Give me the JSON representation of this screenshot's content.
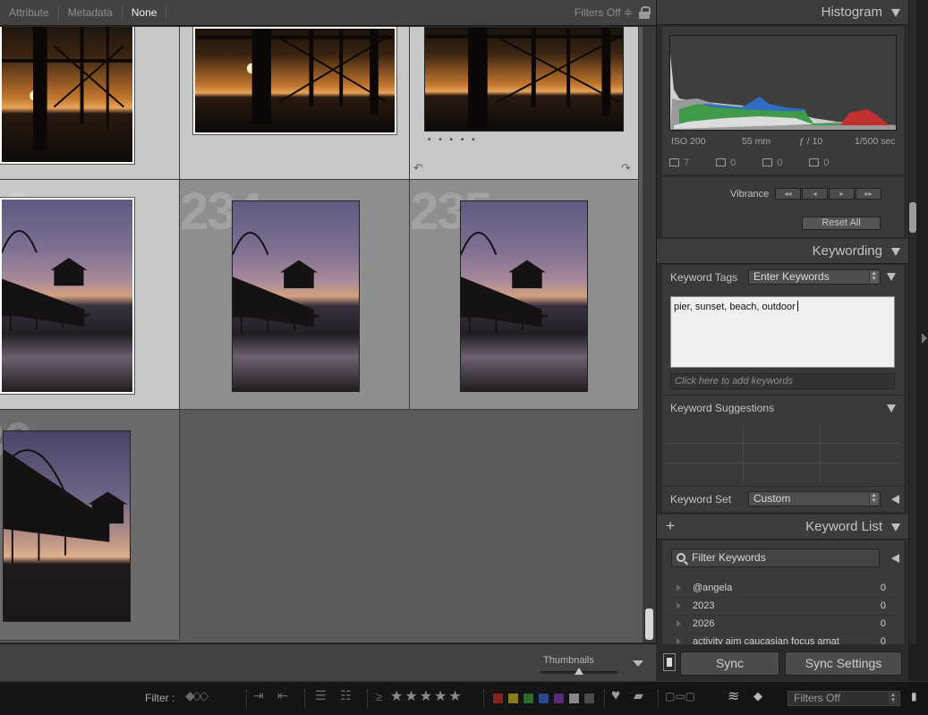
{
  "filter_bar": {
    "tabs": [
      "Attribute",
      "Metadata",
      "None"
    ],
    "selected_tab": "None",
    "filters_label": "Filters Off ≑"
  },
  "grid": {
    "cells": [
      {
        "number": "",
        "state": "selected"
      },
      {
        "number": "",
        "state": "selected"
      },
      {
        "number": "",
        "state": "selected"
      },
      {
        "number": "233",
        "state": "selected"
      },
      {
        "number": "234",
        "state": "unselected"
      },
      {
        "number": "235",
        "state": "unselected"
      },
      {
        "number": "236",
        "state": "dim"
      }
    ],
    "dots": "• • • • •"
  },
  "toolbar": {
    "thumbnails_label": "Thumbnails",
    "thumbnail_size": 0.5
  },
  "histogram": {
    "title": "Histogram",
    "iso": "ISO 200",
    "focal": "55 mm",
    "aperture": "ƒ / 10",
    "shutter": "1/500 sec",
    "counts": [
      "7",
      "0",
      "0",
      "0"
    ]
  },
  "quick_develop": {
    "vibrance_label": "Vibrance",
    "vibrance_buttons": [
      "◂◂",
      "◂",
      "▸",
      "▸▸"
    ],
    "reset_all": "Reset All"
  },
  "keywording": {
    "title": "Keywording",
    "keyword_tags_label": "Keyword Tags",
    "keyword_tags_value": "Enter Keywords",
    "keywords_text": "pier, sunset, beach, outdoor",
    "add_placeholder": "Click here to add keywords",
    "suggestions_label": "Keyword Suggestions",
    "keyword_set_label": "Keyword Set",
    "keyword_set_value": "Custom"
  },
  "keyword_list": {
    "title": "Keyword List",
    "filter_placeholder": "Filter Keywords",
    "items": [
      {
        "name": "@angela",
        "count": "0"
      },
      {
        "name": "2023",
        "count": "0"
      },
      {
        "name": "2026",
        "count": "0"
      },
      {
        "name": "activity aim caucasian focus amat",
        "count": "0"
      }
    ]
  },
  "sync": {
    "sync_label": "Sync",
    "sync_settings_label": "Sync Settings"
  },
  "filmstrip_bar": {
    "filter_label": "Filter :",
    "rating_op": "≥",
    "stars": [
      "★",
      "★",
      "★",
      "★",
      "★"
    ],
    "color_labels": [
      "#8b2020",
      "#8a7d1f",
      "#2a6a2a",
      "#2a4a8a",
      "#5a2a7a",
      "#6a6a6a",
      "#4a4a4a"
    ],
    "filters_value": "Filters Off"
  }
}
